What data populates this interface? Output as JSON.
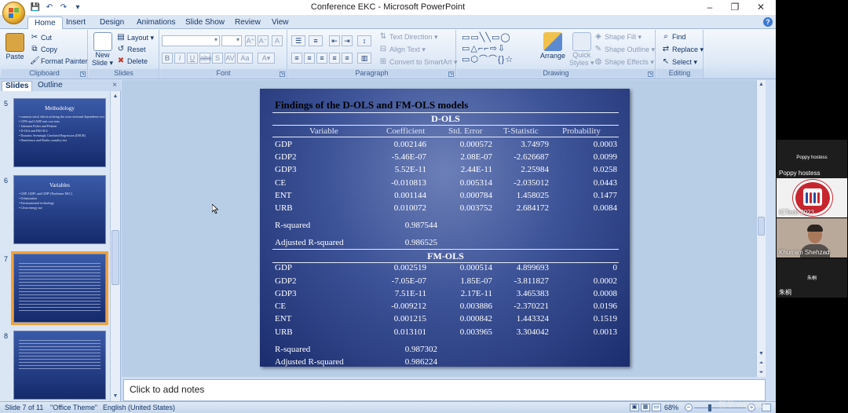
{
  "window": {
    "title": "Conference EKC - Microsoft PowerPoint",
    "minimize": "–",
    "maximize": "❐",
    "close": "✕"
  },
  "qat": {
    "save": "💾",
    "undo": "↶",
    "redo": "↷",
    "customize": "▾"
  },
  "tabs": [
    "Home",
    "Insert",
    "Design",
    "Animations",
    "Slide Show",
    "Review",
    "View"
  ],
  "ribbon": {
    "clipboard": {
      "label": "Clipboard",
      "paste": "Paste",
      "cut": "Cut",
      "copy": "Copy",
      "format_painter": "Format Painter"
    },
    "slides": {
      "label": "Slides",
      "new_slide_1": "New",
      "new_slide_2": "Slide ▾",
      "layout": "Layout ▾",
      "reset": "Reset",
      "delete": "Delete"
    },
    "font": {
      "label": "Font"
    },
    "paragraph": {
      "label": "Paragraph",
      "text_direction": "Text Direction ▾",
      "align_text": "Align Text ▾",
      "convert_smartart": "Convert to SmartArt ▾"
    },
    "drawing": {
      "label": "Drawing",
      "arrange": "Arrange",
      "quick_styles_1": "Quick",
      "quick_styles_2": "Styles ▾",
      "shape_fill": "Shape Fill ▾",
      "shape_outline": "Shape Outline ▾",
      "shape_effects": "Shape Effects ▾"
    },
    "editing": {
      "label": "Editing",
      "find": "Find",
      "replace": "Replace ▾",
      "select": "Select ▾"
    }
  },
  "slides_pane": {
    "tab_slides": "Slides",
    "tab_outline": "Outline",
    "close": "×",
    "thumbs": [
      {
        "num": "5",
        "title": "Methodology",
        "bullets": [
          "common stock effects utilizing the cross-sectional dependence test",
          "CIPS and CADF unit root tests",
          "Johansen Fisher and Pedroni",
          "D-OLS and FM-OLS",
          "Dynamic Seemingly Unrelated Regression (DSUR)",
          "Dumitrescu and Hurlin causality test"
        ]
      },
      {
        "num": "6",
        "title": "Variables",
        "bullets": [
          "GDP, GDP², and GDP³ (Nonlinear EKC)",
          "Urbanization",
          "Environmental technology",
          "Clean energy use"
        ]
      },
      {
        "num": "7",
        "title": "",
        "bullets": []
      },
      {
        "num": "8",
        "title": "",
        "bullets": []
      }
    ]
  },
  "slide": {
    "title": "Findings of the D-OLS and FM-OLS models",
    "headers": [
      "Variable",
      "Coefficient",
      "Std. Error",
      "T-Statistic",
      "Probability"
    ],
    "dols": {
      "label": "D-OLS",
      "rows": [
        [
          "GDP",
          "0.002146",
          "0.000572",
          "3.74979",
          "0.0003"
        ],
        [
          "GDP2",
          "-5.46E-07",
          "2.08E-07",
          "-2.626687",
          "0.0099"
        ],
        [
          "GDP3",
          "5.52E-11",
          "2.44E-11",
          "2.25984",
          "0.0258"
        ],
        [
          "CE",
          "-0.010813",
          "0.005314",
          "-2.035012",
          "0.0443"
        ],
        [
          "ENT",
          "0.001144",
          "0.000784",
          "1.458025",
          "0.1477"
        ],
        [
          "URB",
          "0.010072",
          "0.003752",
          "2.684172",
          "0.0084"
        ]
      ],
      "r_squared_label": "R-squared",
      "r_squared": "0.987544",
      "adj_r_squared_label": "Adjusted R-squared",
      "adj_r_squared": "0.986525"
    },
    "fmols": {
      "label": "FM-OLS",
      "rows": [
        [
          "GDP",
          "0.002519",
          "0.000514",
          "4.899693",
          "0"
        ],
        [
          "GDP2",
          "-7.05E-07",
          "1.85E-07",
          "-3.811827",
          "0.0002"
        ],
        [
          "GDP3",
          "7.51E-11",
          "2.17E-11",
          "3.465383",
          "0.0008"
        ],
        [
          "CE",
          "-0.009212",
          "0.003886",
          "-2.370221",
          "0.0196"
        ],
        [
          "ENT",
          "0.001215",
          "0.000842",
          "1.443324",
          "0.1519"
        ],
        [
          "URB",
          "0.013101",
          "0.003965",
          "3.304042",
          "0.0013"
        ]
      ],
      "r_squared_label": "R-squared",
      "r_squared": "0.987302",
      "adj_r_squared_label": "Adjusted R-squared",
      "adj_r_squared": "0.986224"
    }
  },
  "notes_placeholder": "Click to add notes",
  "status": {
    "slide_counter": "Slide 7 of 11",
    "theme": "\"Office Theme\"",
    "language": "English (United States)",
    "zoom": "68%"
  },
  "meeting": {
    "host_banner": "Poppy hostess",
    "host_name": "Poppy hostess",
    "ictech_name": "ICTech 2023",
    "khurram_name": "Khurram Shehzad",
    "zhu_banner": "朱桐",
    "zhu_name": "朱桐"
  },
  "watermark": "新华 WiFi Biz"
}
